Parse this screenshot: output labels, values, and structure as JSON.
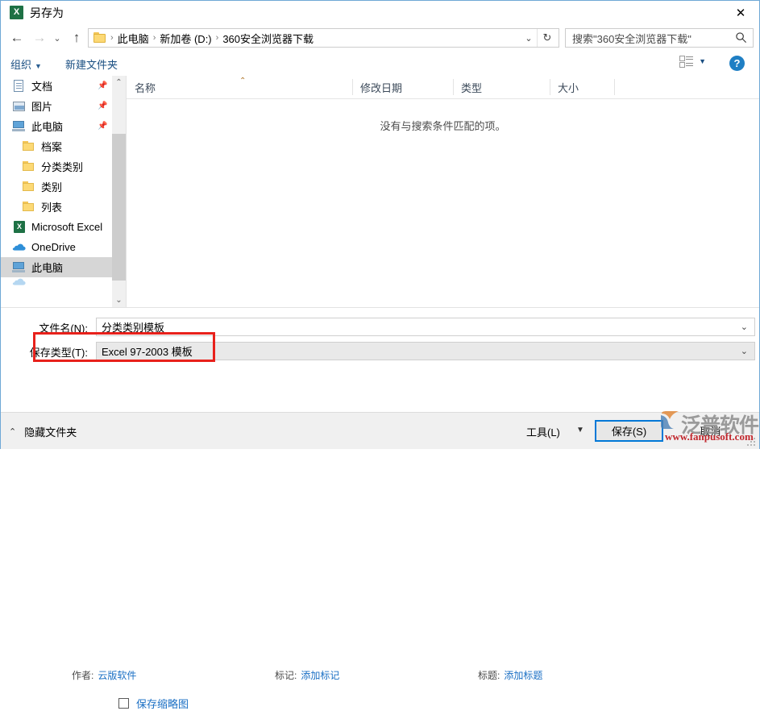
{
  "titlebar": {
    "title": "另存为",
    "app_icon": "excel-icon",
    "close_label": "✕"
  },
  "navbar": {
    "back_icon": "←",
    "forward_icon": "→",
    "recent_icon": "⌄",
    "up_icon": "↑",
    "breadcrumbs": [
      "此电脑",
      "新加卷 (D:)",
      "360安全浏览器下载"
    ],
    "separator": "›",
    "address_dropdown_icon": "⌄",
    "refresh_icon": "↻",
    "search": {
      "placeholder": "搜索\"360安全浏览器下载\"",
      "icon": "search-icon"
    }
  },
  "toolbar": {
    "organize_label": "组织",
    "organize_caret": "▼",
    "new_folder_label": "新建文件夹",
    "view_caret": "▼",
    "help_label": "?"
  },
  "sidebar": {
    "items": [
      {
        "label": "文档",
        "icon": "document-icon",
        "pinned": true,
        "indent": false,
        "selected": false
      },
      {
        "label": "图片",
        "icon": "pictures-icon",
        "pinned": true,
        "indent": false,
        "selected": false
      },
      {
        "label": "此电脑",
        "icon": "computer-icon",
        "pinned": true,
        "indent": false,
        "selected": false
      },
      {
        "label": "档案",
        "icon": "folder-icon",
        "pinned": false,
        "indent": true,
        "selected": false
      },
      {
        "label": "分类类别",
        "icon": "folder-icon",
        "pinned": false,
        "indent": true,
        "selected": false
      },
      {
        "label": "类别",
        "icon": "folder-icon",
        "pinned": false,
        "indent": true,
        "selected": false
      },
      {
        "label": "列表",
        "icon": "folder-icon",
        "pinned": false,
        "indent": true,
        "selected": false
      },
      {
        "label": "Microsoft Excel",
        "icon": "excel-icon",
        "pinned": false,
        "indent": false,
        "selected": false
      },
      {
        "label": "OneDrive",
        "icon": "onedrive-cloud-icon",
        "pinned": false,
        "indent": false,
        "selected": false
      },
      {
        "label": "此电脑",
        "icon": "computer-icon",
        "pinned": false,
        "indent": false,
        "selected": true
      }
    ],
    "pin_icon": "📌",
    "scroll_up_icon": "⌃",
    "scroll_down_icon": "⌄"
  },
  "filepane": {
    "columns": [
      {
        "label": "名称",
        "sorted": true,
        "sort_icon": "⌃"
      },
      {
        "label": "修改日期",
        "sorted": false
      },
      {
        "label": "类型",
        "sorted": false
      },
      {
        "label": "大小",
        "sorted": false
      }
    ],
    "empty_message": "没有与搜索条件匹配的项。"
  },
  "form": {
    "filename_label": "文件名(N):",
    "filename_value": "分类类别模板",
    "filetype_label": "保存类型(T):",
    "filetype_value": "Excel 97-2003 模板",
    "dropdown_icon": "⌄",
    "highlight_color": "#e8211b",
    "metadata": [
      {
        "key": "作者:",
        "value": "云版软件"
      },
      {
        "key": "标记:",
        "value": "添加标记"
      },
      {
        "key": "标题:",
        "value": "添加标题"
      }
    ],
    "thumbnail_label": "保存缩略图",
    "thumbnail_checked": false
  },
  "footer": {
    "hide_folders_label": "隐藏文件夹",
    "hide_folders_caret": "⌃",
    "tools_label": "工具(L)",
    "tools_caret": "▼",
    "save_label": "保存(S)",
    "cancel_label": "取消",
    "save_accent_color": "#0078d7"
  },
  "watermark": {
    "brand": "泛普软件",
    "url": "www.fanpusoft.com"
  }
}
